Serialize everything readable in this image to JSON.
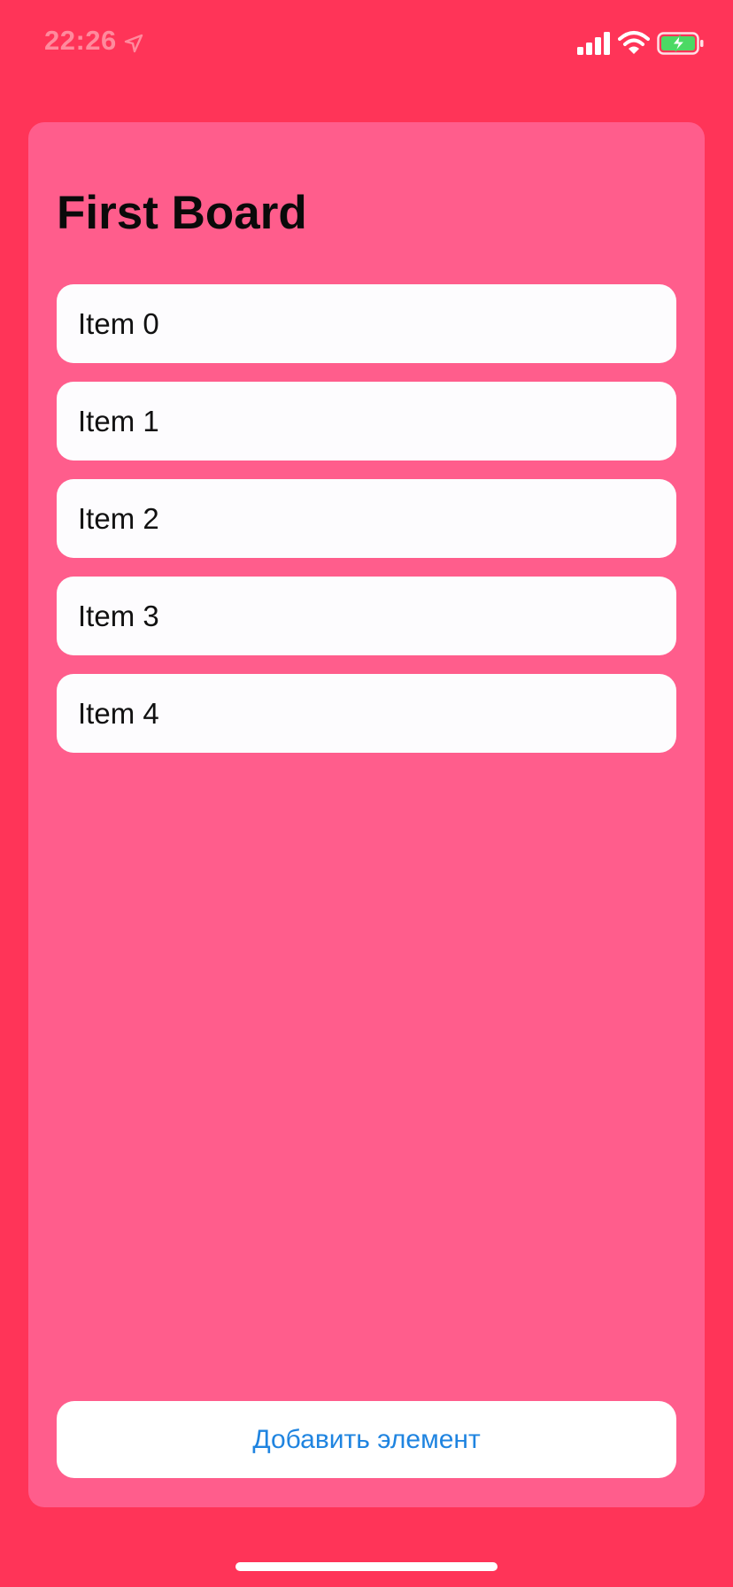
{
  "status_bar": {
    "time": "22:26",
    "icons": [
      "location-arrow-icon",
      "cellular-signal-icon",
      "wifi-icon",
      "battery-charging-icon"
    ]
  },
  "board": {
    "title": "First Board",
    "items": [
      {
        "label": "Item 0"
      },
      {
        "label": "Item 1"
      },
      {
        "label": "Item 2"
      },
      {
        "label": "Item 3"
      },
      {
        "label": "Item 4"
      }
    ],
    "add_button_label": "Добавить элемент"
  },
  "colors": {
    "background": "#ff3458",
    "card": "#ff5d8c",
    "item_bg": "#fdfcfe",
    "button_text": "#1f84e0",
    "battery_fill": "#4cd964"
  }
}
